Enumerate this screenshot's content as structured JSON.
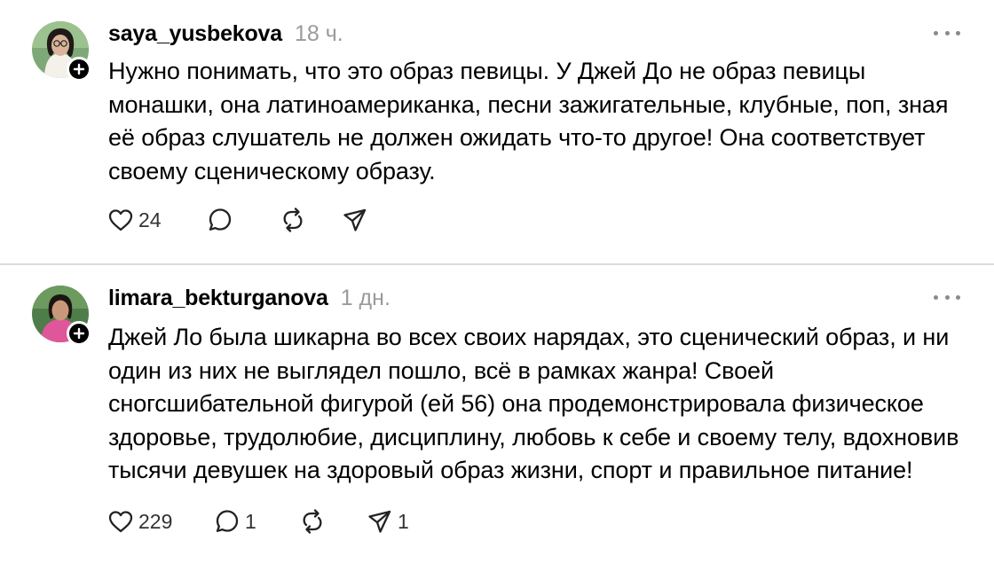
{
  "comments": [
    {
      "username": "saya_yusbekova",
      "timestamp": "18 ч.",
      "text": "Нужно понимать, что это образ певицы. У Джей До не образ певицы монашки, она латиноамериканка, песни зажигательные, клубные, поп, зная её образ слушатель не должен ожидать что-то другое! Она соответствует своему сценическому образу.",
      "likes": "24",
      "replies": "",
      "reposts": "",
      "shares": ""
    },
    {
      "username": "limara_bekturganova",
      "timestamp": "1 дн.",
      "text": "Джей Ло была шикарна во всех своих нарядах, это сценический образ, и ни один из них не выглядел пошло, всё в рамках жанра! Своей сногсшибательной фигурой (ей 56) она продемонстрировала физическое здоровье, трудолюбие, дисциплину, любовь к себе и своему телу, вдохновив тысячи девушек на здоровый образ жизни, спорт и правильное питание!",
      "likes": "229",
      "replies": "1",
      "reposts": "",
      "shares": "1"
    }
  ],
  "icons": {
    "like": "heart-icon",
    "reply": "comment-icon",
    "repost": "repost-icon",
    "share": "share-icon",
    "more": "more-icon",
    "follow": "plus-icon"
  },
  "colors": {
    "text": "#000000",
    "muted": "#9a9a9a",
    "divider": "#dcdcdc",
    "icon": "#222222"
  }
}
